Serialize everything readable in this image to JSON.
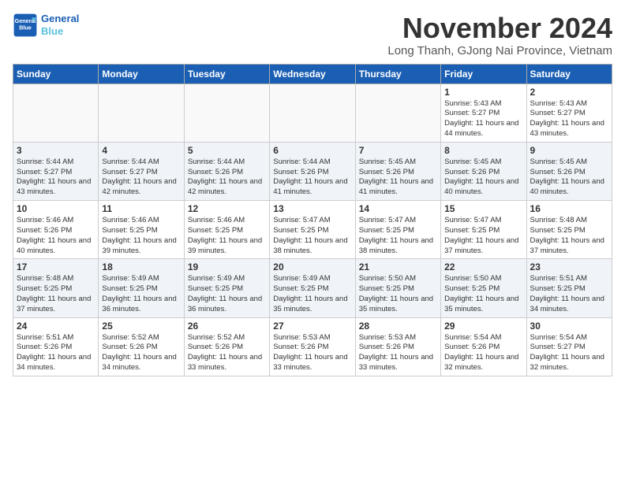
{
  "header": {
    "logo_line1": "General",
    "logo_line2": "Blue",
    "month_title": "November 2024",
    "subtitle": "Long Thanh, GJong Nai Province, Vietnam"
  },
  "weekdays": [
    "Sunday",
    "Monday",
    "Tuesday",
    "Wednesday",
    "Thursday",
    "Friday",
    "Saturday"
  ],
  "weeks": [
    [
      {
        "day": "",
        "info": ""
      },
      {
        "day": "",
        "info": ""
      },
      {
        "day": "",
        "info": ""
      },
      {
        "day": "",
        "info": ""
      },
      {
        "day": "",
        "info": ""
      },
      {
        "day": "1",
        "info": "Sunrise: 5:43 AM\nSunset: 5:27 PM\nDaylight: 11 hours and 44 minutes."
      },
      {
        "day": "2",
        "info": "Sunrise: 5:43 AM\nSunset: 5:27 PM\nDaylight: 11 hours and 43 minutes."
      }
    ],
    [
      {
        "day": "3",
        "info": "Sunrise: 5:44 AM\nSunset: 5:27 PM\nDaylight: 11 hours and 43 minutes."
      },
      {
        "day": "4",
        "info": "Sunrise: 5:44 AM\nSunset: 5:27 PM\nDaylight: 11 hours and 42 minutes."
      },
      {
        "day": "5",
        "info": "Sunrise: 5:44 AM\nSunset: 5:26 PM\nDaylight: 11 hours and 42 minutes."
      },
      {
        "day": "6",
        "info": "Sunrise: 5:44 AM\nSunset: 5:26 PM\nDaylight: 11 hours and 41 minutes."
      },
      {
        "day": "7",
        "info": "Sunrise: 5:45 AM\nSunset: 5:26 PM\nDaylight: 11 hours and 41 minutes."
      },
      {
        "day": "8",
        "info": "Sunrise: 5:45 AM\nSunset: 5:26 PM\nDaylight: 11 hours and 40 minutes."
      },
      {
        "day": "9",
        "info": "Sunrise: 5:45 AM\nSunset: 5:26 PM\nDaylight: 11 hours and 40 minutes."
      }
    ],
    [
      {
        "day": "10",
        "info": "Sunrise: 5:46 AM\nSunset: 5:26 PM\nDaylight: 11 hours and 40 minutes."
      },
      {
        "day": "11",
        "info": "Sunrise: 5:46 AM\nSunset: 5:25 PM\nDaylight: 11 hours and 39 minutes."
      },
      {
        "day": "12",
        "info": "Sunrise: 5:46 AM\nSunset: 5:25 PM\nDaylight: 11 hours and 39 minutes."
      },
      {
        "day": "13",
        "info": "Sunrise: 5:47 AM\nSunset: 5:25 PM\nDaylight: 11 hours and 38 minutes."
      },
      {
        "day": "14",
        "info": "Sunrise: 5:47 AM\nSunset: 5:25 PM\nDaylight: 11 hours and 38 minutes."
      },
      {
        "day": "15",
        "info": "Sunrise: 5:47 AM\nSunset: 5:25 PM\nDaylight: 11 hours and 37 minutes."
      },
      {
        "day": "16",
        "info": "Sunrise: 5:48 AM\nSunset: 5:25 PM\nDaylight: 11 hours and 37 minutes."
      }
    ],
    [
      {
        "day": "17",
        "info": "Sunrise: 5:48 AM\nSunset: 5:25 PM\nDaylight: 11 hours and 37 minutes."
      },
      {
        "day": "18",
        "info": "Sunrise: 5:49 AM\nSunset: 5:25 PM\nDaylight: 11 hours and 36 minutes."
      },
      {
        "day": "19",
        "info": "Sunrise: 5:49 AM\nSunset: 5:25 PM\nDaylight: 11 hours and 36 minutes."
      },
      {
        "day": "20",
        "info": "Sunrise: 5:49 AM\nSunset: 5:25 PM\nDaylight: 11 hours and 35 minutes."
      },
      {
        "day": "21",
        "info": "Sunrise: 5:50 AM\nSunset: 5:25 PM\nDaylight: 11 hours and 35 minutes."
      },
      {
        "day": "22",
        "info": "Sunrise: 5:50 AM\nSunset: 5:25 PM\nDaylight: 11 hours and 35 minutes."
      },
      {
        "day": "23",
        "info": "Sunrise: 5:51 AM\nSunset: 5:25 PM\nDaylight: 11 hours and 34 minutes."
      }
    ],
    [
      {
        "day": "24",
        "info": "Sunrise: 5:51 AM\nSunset: 5:26 PM\nDaylight: 11 hours and 34 minutes."
      },
      {
        "day": "25",
        "info": "Sunrise: 5:52 AM\nSunset: 5:26 PM\nDaylight: 11 hours and 34 minutes."
      },
      {
        "day": "26",
        "info": "Sunrise: 5:52 AM\nSunset: 5:26 PM\nDaylight: 11 hours and 33 minutes."
      },
      {
        "day": "27",
        "info": "Sunrise: 5:53 AM\nSunset: 5:26 PM\nDaylight: 11 hours and 33 minutes."
      },
      {
        "day": "28",
        "info": "Sunrise: 5:53 AM\nSunset: 5:26 PM\nDaylight: 11 hours and 33 minutes."
      },
      {
        "day": "29",
        "info": "Sunrise: 5:54 AM\nSunset: 5:26 PM\nDaylight: 11 hours and 32 minutes."
      },
      {
        "day": "30",
        "info": "Sunrise: 5:54 AM\nSunset: 5:27 PM\nDaylight: 11 hours and 32 minutes."
      }
    ]
  ]
}
